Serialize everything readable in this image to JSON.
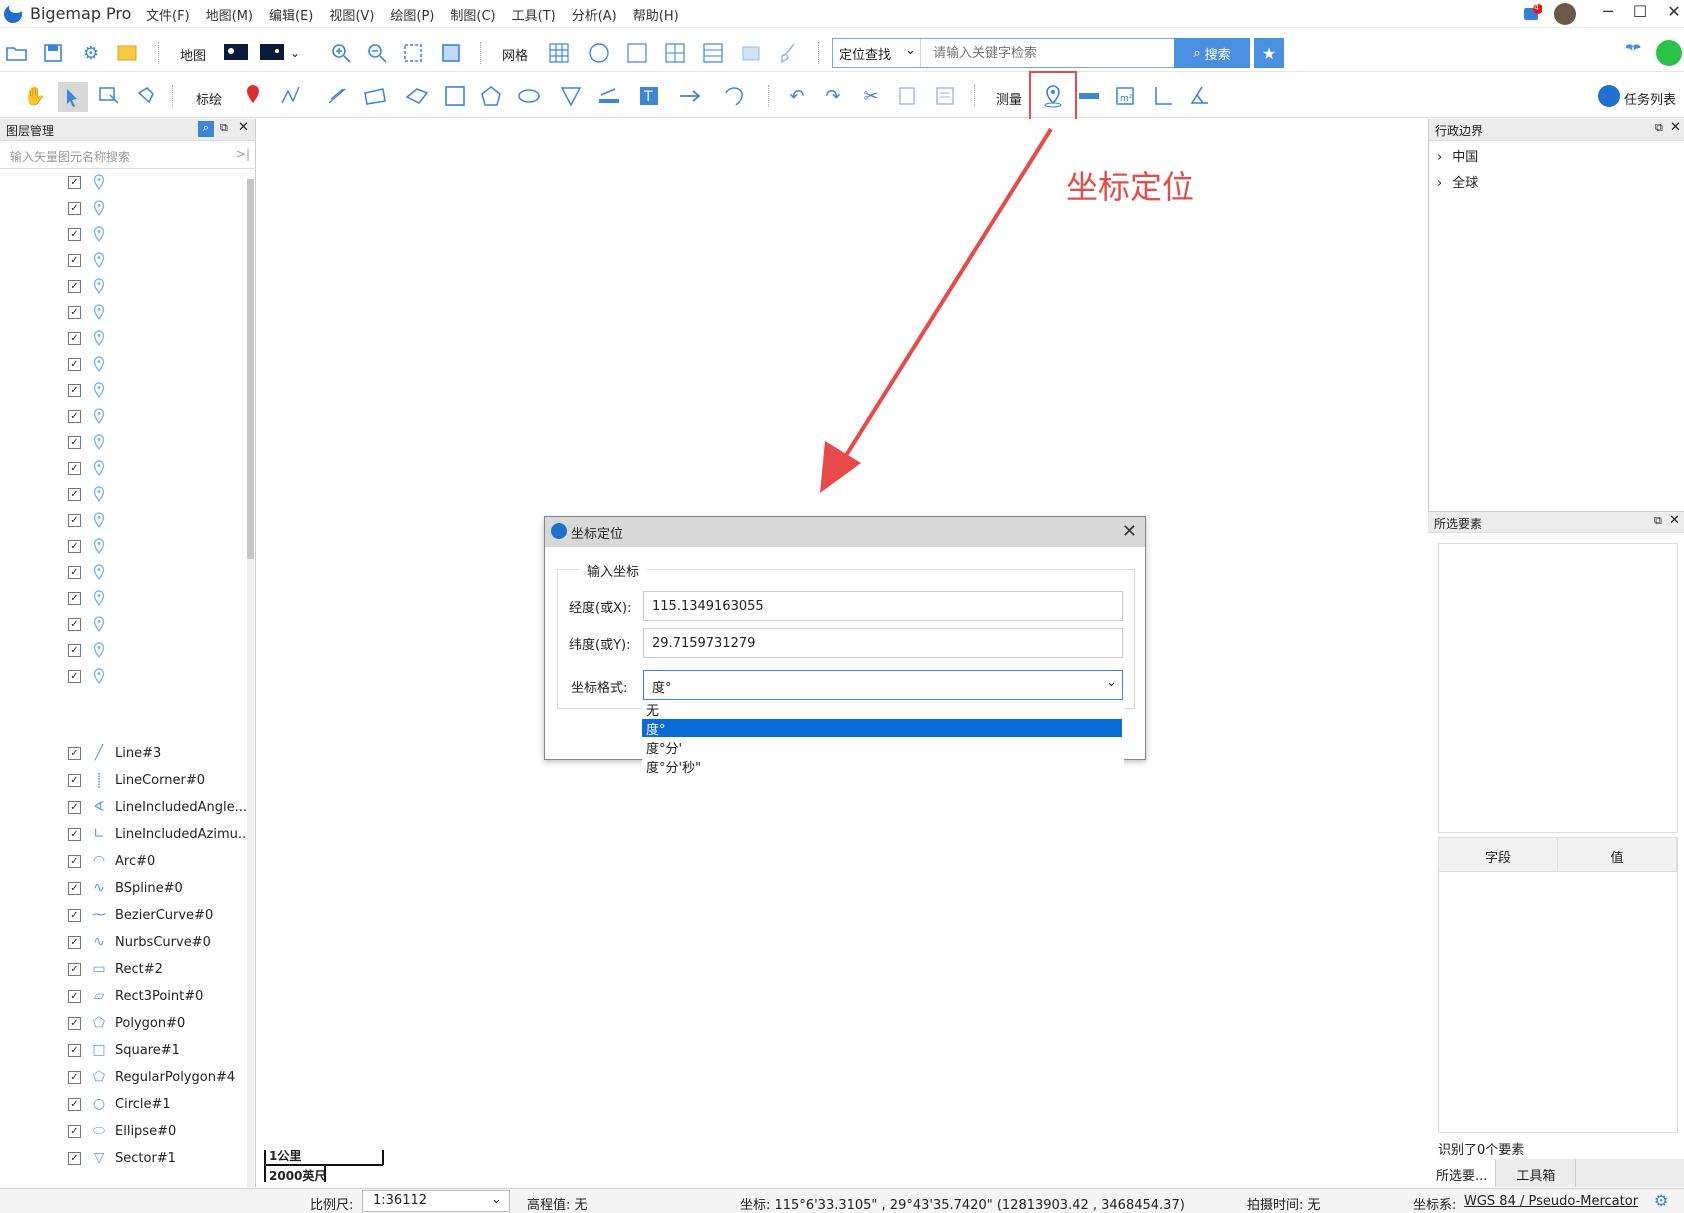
{
  "app": {
    "title": "Bigemap Pro"
  },
  "menu": [
    "文件(F)",
    "地图(M)",
    "编辑(E)",
    "视图(V)",
    "绘图(P)",
    "制图(C)",
    "工具(T)",
    "分析(A)",
    "帮助(H)"
  ],
  "notification_count": "4",
  "toolbar1": {
    "map_label": "地图",
    "grid_label": "网格",
    "search_mode": "定位查找",
    "search_placeholder": "请输入关键字检索",
    "search_button": "搜索"
  },
  "toolbar2": {
    "plot_label": "标绘",
    "measure_label": "测量",
    "task_list": "任务列表"
  },
  "left_panel": {
    "title": "图层管理",
    "search_placeholder": "输入矢量图元名称搜索",
    "named_layers": [
      "Line#3",
      "LineCorner#0",
      "LineIncludedAngle...",
      "LineIncludedAzimu...",
      "Arc#0",
      "BSpline#0",
      "BezierCurve#0",
      "NurbsCurve#0",
      "Rect#2",
      "Rect3Point#0",
      "Polygon#0",
      "Square#1",
      "RegularPolygon#4",
      "Circle#1",
      "Ellipse#0",
      "Sector#1"
    ]
  },
  "right_panel": {
    "title": "行政边界",
    "tree": [
      "中国",
      "全球"
    ],
    "selected_title": "所选要素",
    "field_col": "字段",
    "value_col": "值",
    "count_text": "识别了0个要素",
    "tabs": [
      "所选要...",
      "工具箱"
    ]
  },
  "annotation": "坐标定位",
  "scale_bar": {
    "top": "1公里",
    "bottom": "2000英尺"
  },
  "dialog": {
    "title": "坐标定位",
    "group": "输入坐标",
    "lon_label": "经度(或X):",
    "lon_value": "115.1349163055",
    "lat_label": "纬度(或Y):",
    "lat_value": "29.7159731279",
    "format_label": "坐标格式:",
    "format_value": "度°",
    "format_options": [
      "无",
      "度°",
      "度°分'",
      "度°分'秒\""
    ],
    "selected_option_index": 1
  },
  "status": {
    "scale_label": "比例尺:",
    "scale_value": "1:36112",
    "elevation": "高程值: 无",
    "coords": "坐标: 115°6'33.3105\" , 29°43'35.7420\"   (12813903.42 , 3468454.37)",
    "capture_time": "拍摄时间: 无",
    "crs_label": "坐标系:",
    "crs_value": "WGS 84 / Pseudo-Mercator"
  }
}
